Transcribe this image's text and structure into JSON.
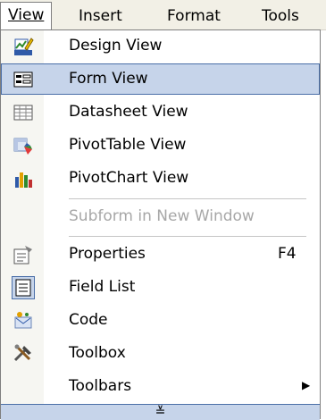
{
  "menubar": {
    "view": "View",
    "insert": "Insert",
    "format": "Format",
    "tools": "Tools"
  },
  "menu": {
    "items": [
      {
        "label": "Design View",
        "icon": "design-view-icon"
      },
      {
        "label": "Form View",
        "icon": "form-view-icon",
        "selected": true
      },
      {
        "label": "Datasheet View",
        "icon": "datasheet-view-icon"
      },
      {
        "label": "PivotTable View",
        "icon": "pivottable-view-icon"
      },
      {
        "label": "PivotChart View",
        "icon": "pivotchart-view-icon"
      },
      {
        "label": "Subform in New Window",
        "disabled": true
      },
      {
        "label": "Properties",
        "shortcut": "F4",
        "icon": "properties-icon"
      },
      {
        "label": "Field List",
        "icon": "field-list-icon"
      },
      {
        "label": "Code",
        "icon": "code-icon"
      },
      {
        "label": "Toolbox",
        "icon": "toolbox-icon"
      },
      {
        "label": "Toolbars",
        "submenu": true
      }
    ],
    "properties_shortcut": "F4",
    "expand_glyph": "≚"
  }
}
